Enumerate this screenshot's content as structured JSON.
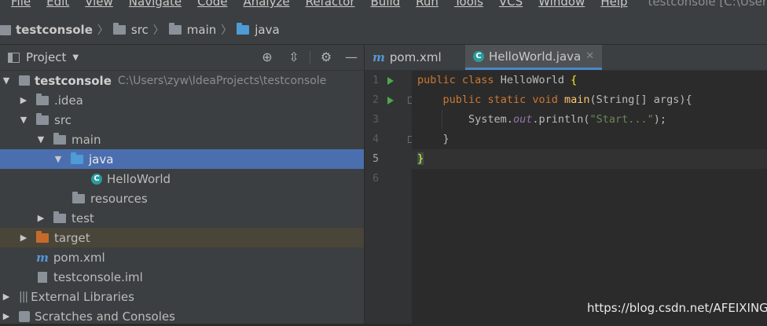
{
  "menu": [
    "File",
    "Edit",
    "View",
    "Navigate",
    "Code",
    "Analyze",
    "Refactor",
    "Build",
    "Run",
    "Tools",
    "VCS",
    "Window",
    "Help"
  ],
  "window_title": "testconsole [C:\\Users\\zyw\\Ide",
  "breadcrumb": [
    "testconsole",
    "src",
    "main",
    "java"
  ],
  "project_panel": {
    "title": "Project"
  },
  "tree": [
    {
      "label": "testconsole",
      "path": "C:\\Users\\zyw\\IdeaProjects\\testconsole"
    },
    {
      "label": ".idea"
    },
    {
      "label": "src"
    },
    {
      "label": "main"
    },
    {
      "label": "java"
    },
    {
      "label": "HelloWorld"
    },
    {
      "label": "resources"
    },
    {
      "label": "test"
    },
    {
      "label": "target"
    },
    {
      "label": "pom.xml"
    },
    {
      "label": "testconsole.iml"
    },
    {
      "label": "External Libraries"
    },
    {
      "label": "Scratches and Consoles"
    }
  ],
  "tabs": [
    {
      "label": "pom.xml"
    },
    {
      "label": "HelloWorld.java"
    }
  ],
  "line_numbers": [
    "1",
    "2",
    "3",
    "4",
    "5",
    "6"
  ],
  "code": {
    "l1": {
      "kw1": "public",
      "kw2": "class",
      "name": "HelloWorld",
      "brace": "{"
    },
    "l2": {
      "kw1": "public",
      "kw2": "static",
      "kw3": "void",
      "fn": "main",
      "rest": "(String[] args){"
    },
    "l3": {
      "pre": "System.",
      "field": "out",
      "mid": ".println(",
      "str": "\"Start...\"",
      "end": ");"
    },
    "l4": {
      "text": "}"
    },
    "l5": {
      "text": "}"
    }
  },
  "watermark": "https://blog.csdn.net/AFEIXING",
  "colors": {
    "selection": "#4b6eaf",
    "keyword": "#cc7832",
    "string": "#6a8759",
    "function": "#ffc66d"
  }
}
